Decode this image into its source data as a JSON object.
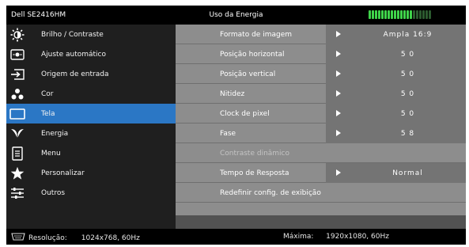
{
  "header": {
    "model": "Dell SE2416HM",
    "title": "Uso da Energia",
    "energy_bars_total": 20,
    "energy_bars_lit": 14
  },
  "sidebar": {
    "items": [
      {
        "label": "Brilho / Contraste",
        "icon": "brightness-icon"
      },
      {
        "label": "Ajuste automático",
        "icon": "auto-adjust-icon"
      },
      {
        "label": "Origem de entrada",
        "icon": "input-source-icon"
      },
      {
        "label": "Cor",
        "icon": "color-icon"
      },
      {
        "label": "Tela",
        "icon": "display-icon",
        "active": true
      },
      {
        "label": "Energia",
        "icon": "energy-icon"
      },
      {
        "label": "Menu",
        "icon": "menu-icon"
      },
      {
        "label": "Personalizar",
        "icon": "star-icon"
      },
      {
        "label": "Outros",
        "icon": "others-icon"
      }
    ]
  },
  "settings": [
    {
      "label": "Formato de imagem",
      "value": "Ampla 16:9"
    },
    {
      "label": "Posição horizontal",
      "value": "5 0"
    },
    {
      "label": "Posição vertical",
      "value": "5 0"
    },
    {
      "label": "Nitidez",
      "value": "5 0"
    },
    {
      "label": "Clock de pixel",
      "value": "5 0"
    },
    {
      "label": "Fase",
      "value": "5 8"
    },
    {
      "label": "Contraste dinâmico",
      "disabled": true
    },
    {
      "label": "Tempo de Resposta",
      "value": "Normal"
    },
    {
      "label": "Redefinir config. de exibição"
    }
  ],
  "footer": {
    "resolution_label": "Resolução:",
    "resolution_value": "1024x768, 60Hz",
    "max_label": "Máxima:",
    "max_value": "1920x1080, 60Hz"
  },
  "colors": {
    "accent": "#2b77c5",
    "energy_on": "#3fd34a"
  }
}
